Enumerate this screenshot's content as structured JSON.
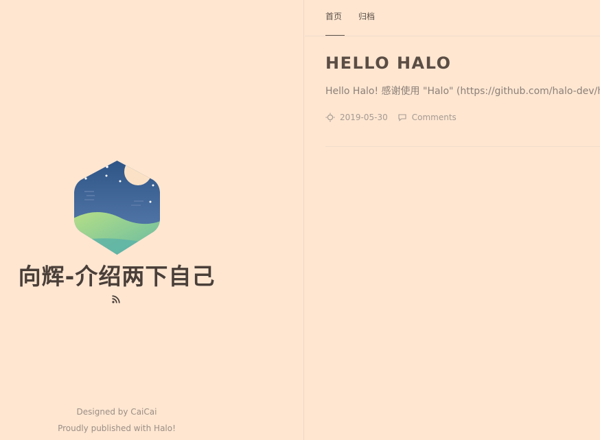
{
  "sidebar": {
    "site_title": "向辉-介绍两下自己",
    "rss_icon": "rss-icon",
    "footer": {
      "designed_by": "Designed by CaiCai",
      "published_with": "Proudly published with Halo!"
    }
  },
  "nav": {
    "items": [
      {
        "label": "首页",
        "active": true
      },
      {
        "label": "归档",
        "active": false
      }
    ]
  },
  "post": {
    "title": "HELLO HALO",
    "excerpt": "Hello Halo! 感谢使用 \"Halo\" (https://github.com/halo-dev/halo",
    "date": "2019-05-30",
    "date_icon": "sun-icon",
    "comments_label": "Comments",
    "comments_icon": "comment-icon"
  },
  "colors": {
    "background": "#fee6d1",
    "title": "#4a3f39",
    "text_muted": "#9b8e84"
  }
}
